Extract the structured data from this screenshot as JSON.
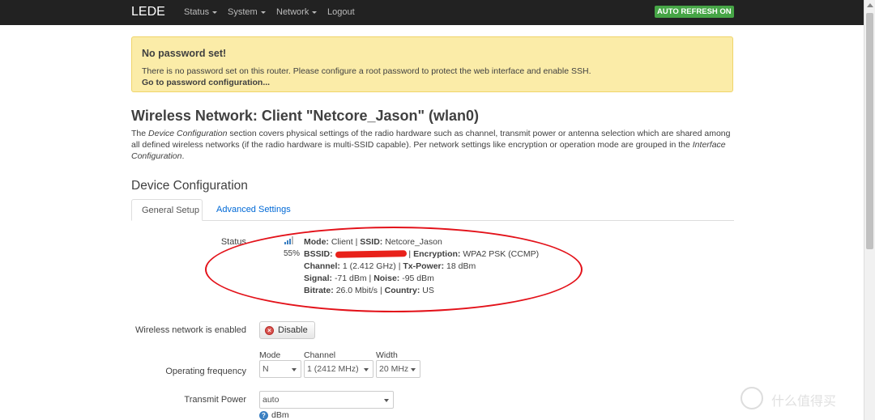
{
  "header": {
    "brand": "LEDE",
    "nav": [
      "Status",
      "System",
      "Network",
      "Logout"
    ],
    "auto_refresh": "AUTO REFRESH ON"
  },
  "alert": {
    "title": "No password set!",
    "text": "There is no password set on this router. Please configure a root password to protect the web interface and enable SSH.",
    "link": "Go to password configuration..."
  },
  "page": {
    "title": "Wireless Network: Client \"Netcore_Jason\" (wlan0)",
    "desc_parts": [
      "The ",
      "Device Configuration",
      " section covers physical settings of the radio hardware such as channel, transmit power or antenna selection which are shared among all defined wireless networks (if the radio hardware is multi-SSID capable). Per network settings like encryption or operation mode are grouped in the ",
      "Interface Configuration",
      "."
    ]
  },
  "section": {
    "title": "Device Configuration",
    "tabs": [
      "General Setup",
      "Advanced Settings"
    ]
  },
  "status": {
    "label": "Status",
    "signal_pct": "55%",
    "mode_k": "Mode:",
    "mode_v": "Client",
    "ssid_k": "SSID:",
    "ssid_v": "Netcore_Jason",
    "bssid_k": "BSSID:",
    "enc_k": "Encryption:",
    "enc_v": "WPA2 PSK (CCMP)",
    "channel_k": "Channel:",
    "channel_v": "1 (2.412 GHz)",
    "txp_k": "Tx-Power:",
    "txp_v": "18 dBm",
    "signal_k": "Signal:",
    "signal_v": "-71 dBm",
    "noise_k": "Noise:",
    "noise_v": "-95 dBm",
    "bitrate_k": "Bitrate:",
    "bitrate_v": "26.0 Mbit/s",
    "country_k": "Country:",
    "country_v": "US"
  },
  "form": {
    "enabled_label": "Wireless network is enabled",
    "disable_btn": "Disable",
    "freq_label": "Operating frequency",
    "mode_cap": "Mode",
    "channel_cap": "Channel",
    "width_cap": "Width",
    "mode_val": "N",
    "channel_val": "1 (2412 MHz)",
    "width_val": "20 MHz",
    "txp_label": "Transmit Power",
    "txp_val": "auto",
    "txp_unit": "dBm"
  },
  "watermark": "什么值得买",
  "colors": {
    "topbar": "#222222",
    "alert_bg": "#fbeca8",
    "link": "#0069d6",
    "annotation": "#e3121a",
    "autorefresh": "#46a546"
  }
}
